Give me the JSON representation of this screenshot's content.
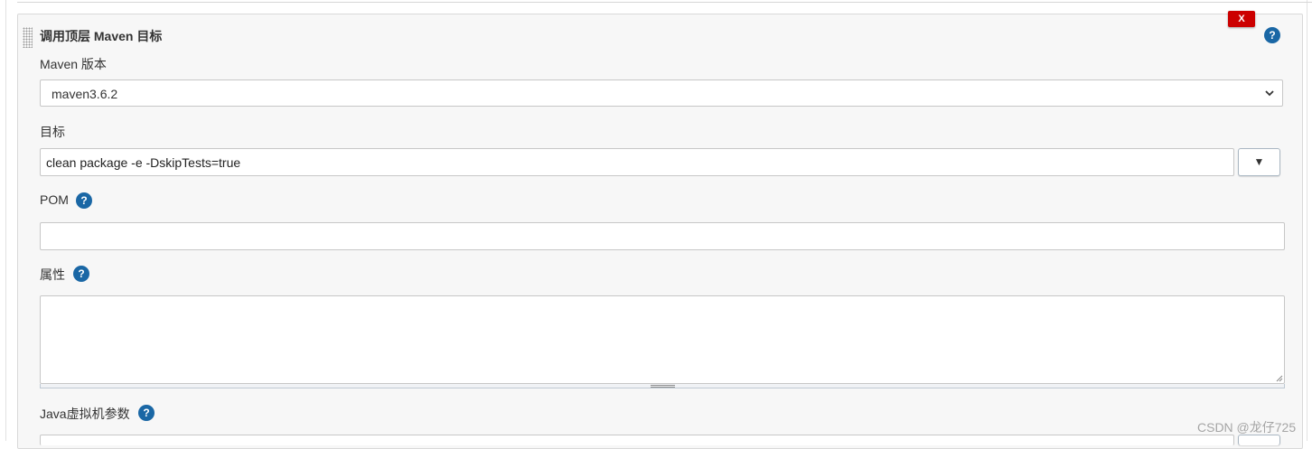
{
  "section": {
    "title": "调用顶层 Maven 目标",
    "delete_label": "X",
    "help_symbol": "?"
  },
  "maven_version": {
    "label": "Maven 版本",
    "selected": "maven3.6.2"
  },
  "goals": {
    "label": "目标",
    "value": "clean package -e -DskipTests=true",
    "expand_symbol": "▼"
  },
  "pom": {
    "label": "POM",
    "value": "",
    "help_symbol": "?"
  },
  "properties": {
    "label": "属性",
    "value": "",
    "help_symbol": "?"
  },
  "jvm_options": {
    "label": "Java虚拟机参数",
    "help_symbol": "?"
  },
  "watermark": "CSDN @龙仔725",
  "colors": {
    "delete_button": "#cc0000",
    "help_icon": "#1a67a5",
    "panel_background": "#f7f7f7"
  }
}
